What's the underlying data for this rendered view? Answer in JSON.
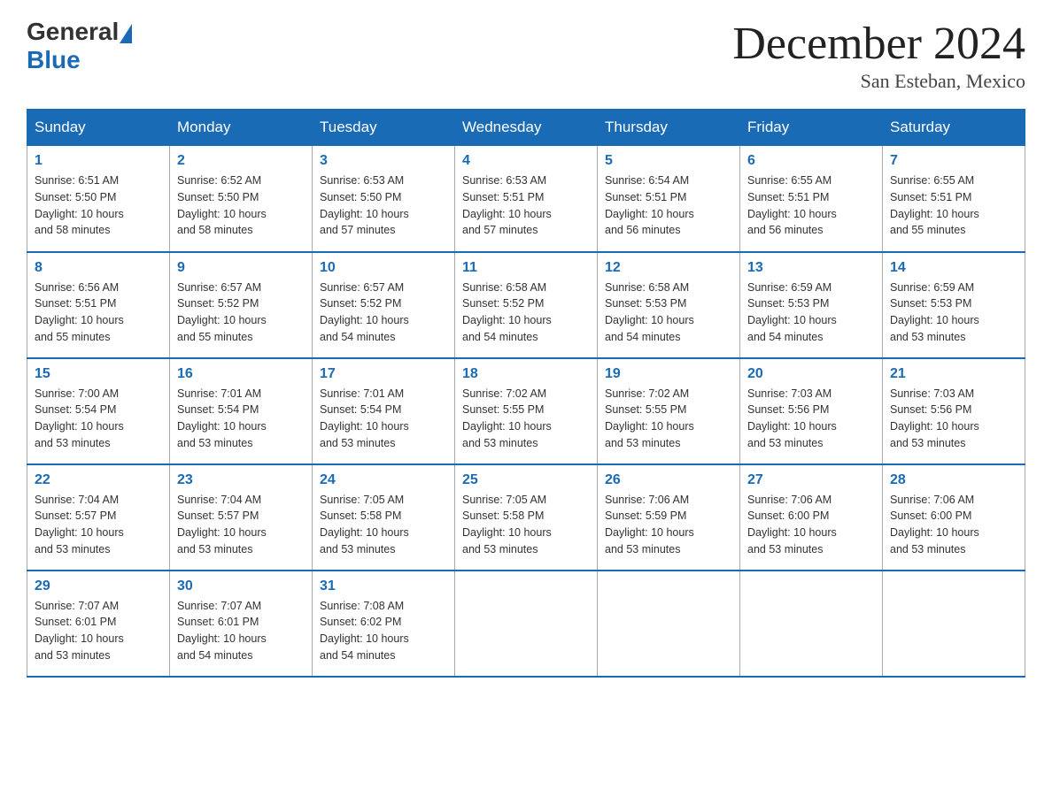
{
  "header": {
    "logo_general": "General",
    "logo_blue": "Blue",
    "month_title": "December 2024",
    "location": "San Esteban, Mexico"
  },
  "weekdays": [
    "Sunday",
    "Monday",
    "Tuesday",
    "Wednesday",
    "Thursday",
    "Friday",
    "Saturday"
  ],
  "weeks": [
    [
      {
        "day": "1",
        "sunrise": "6:51 AM",
        "sunset": "5:50 PM",
        "daylight": "10 hours and 58 minutes."
      },
      {
        "day": "2",
        "sunrise": "6:52 AM",
        "sunset": "5:50 PM",
        "daylight": "10 hours and 58 minutes."
      },
      {
        "day": "3",
        "sunrise": "6:53 AM",
        "sunset": "5:50 PM",
        "daylight": "10 hours and 57 minutes."
      },
      {
        "day": "4",
        "sunrise": "6:53 AM",
        "sunset": "5:51 PM",
        "daylight": "10 hours and 57 minutes."
      },
      {
        "day": "5",
        "sunrise": "6:54 AM",
        "sunset": "5:51 PM",
        "daylight": "10 hours and 56 minutes."
      },
      {
        "day": "6",
        "sunrise": "6:55 AM",
        "sunset": "5:51 PM",
        "daylight": "10 hours and 56 minutes."
      },
      {
        "day": "7",
        "sunrise": "6:55 AM",
        "sunset": "5:51 PM",
        "daylight": "10 hours and 55 minutes."
      }
    ],
    [
      {
        "day": "8",
        "sunrise": "6:56 AM",
        "sunset": "5:51 PM",
        "daylight": "10 hours and 55 minutes."
      },
      {
        "day": "9",
        "sunrise": "6:57 AM",
        "sunset": "5:52 PM",
        "daylight": "10 hours and 55 minutes."
      },
      {
        "day": "10",
        "sunrise": "6:57 AM",
        "sunset": "5:52 PM",
        "daylight": "10 hours and 54 minutes."
      },
      {
        "day": "11",
        "sunrise": "6:58 AM",
        "sunset": "5:52 PM",
        "daylight": "10 hours and 54 minutes."
      },
      {
        "day": "12",
        "sunrise": "6:58 AM",
        "sunset": "5:53 PM",
        "daylight": "10 hours and 54 minutes."
      },
      {
        "day": "13",
        "sunrise": "6:59 AM",
        "sunset": "5:53 PM",
        "daylight": "10 hours and 54 minutes."
      },
      {
        "day": "14",
        "sunrise": "6:59 AM",
        "sunset": "5:53 PM",
        "daylight": "10 hours and 53 minutes."
      }
    ],
    [
      {
        "day": "15",
        "sunrise": "7:00 AM",
        "sunset": "5:54 PM",
        "daylight": "10 hours and 53 minutes."
      },
      {
        "day": "16",
        "sunrise": "7:01 AM",
        "sunset": "5:54 PM",
        "daylight": "10 hours and 53 minutes."
      },
      {
        "day": "17",
        "sunrise": "7:01 AM",
        "sunset": "5:54 PM",
        "daylight": "10 hours and 53 minutes."
      },
      {
        "day": "18",
        "sunrise": "7:02 AM",
        "sunset": "5:55 PM",
        "daylight": "10 hours and 53 minutes."
      },
      {
        "day": "19",
        "sunrise": "7:02 AM",
        "sunset": "5:55 PM",
        "daylight": "10 hours and 53 minutes."
      },
      {
        "day": "20",
        "sunrise": "7:03 AM",
        "sunset": "5:56 PM",
        "daylight": "10 hours and 53 minutes."
      },
      {
        "day": "21",
        "sunrise": "7:03 AM",
        "sunset": "5:56 PM",
        "daylight": "10 hours and 53 minutes."
      }
    ],
    [
      {
        "day": "22",
        "sunrise": "7:04 AM",
        "sunset": "5:57 PM",
        "daylight": "10 hours and 53 minutes."
      },
      {
        "day": "23",
        "sunrise": "7:04 AM",
        "sunset": "5:57 PM",
        "daylight": "10 hours and 53 minutes."
      },
      {
        "day": "24",
        "sunrise": "7:05 AM",
        "sunset": "5:58 PM",
        "daylight": "10 hours and 53 minutes."
      },
      {
        "day": "25",
        "sunrise": "7:05 AM",
        "sunset": "5:58 PM",
        "daylight": "10 hours and 53 minutes."
      },
      {
        "day": "26",
        "sunrise": "7:06 AM",
        "sunset": "5:59 PM",
        "daylight": "10 hours and 53 minutes."
      },
      {
        "day": "27",
        "sunrise": "7:06 AM",
        "sunset": "6:00 PM",
        "daylight": "10 hours and 53 minutes."
      },
      {
        "day": "28",
        "sunrise": "7:06 AM",
        "sunset": "6:00 PM",
        "daylight": "10 hours and 53 minutes."
      }
    ],
    [
      {
        "day": "29",
        "sunrise": "7:07 AM",
        "sunset": "6:01 PM",
        "daylight": "10 hours and 53 minutes."
      },
      {
        "day": "30",
        "sunrise": "7:07 AM",
        "sunset": "6:01 PM",
        "daylight": "10 hours and 54 minutes."
      },
      {
        "day": "31",
        "sunrise": "7:08 AM",
        "sunset": "6:02 PM",
        "daylight": "10 hours and 54 minutes."
      },
      null,
      null,
      null,
      null
    ]
  ],
  "labels": {
    "sunrise": "Sunrise:",
    "sunset": "Sunset:",
    "daylight": "Daylight:"
  }
}
